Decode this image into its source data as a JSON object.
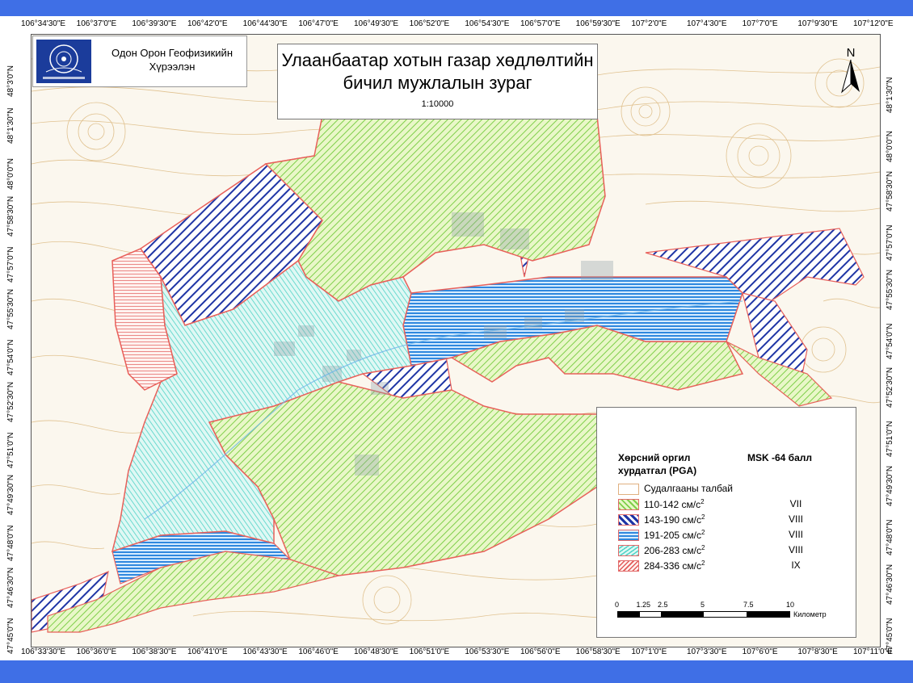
{
  "institute": {
    "line1": "Одон Орон Геофизикийн",
    "line2": "Хүрээлэн",
    "logo": "mongolian-academy-of-sciences-emblem"
  },
  "title": {
    "line1": "Улаанбаатар хотын газар хөдлөлтийн",
    "line2": "бичил мужлалын зураг",
    "scale": "1:10000"
  },
  "north_label": "N",
  "graticule": {
    "top": [
      "106°34'30\"E",
      "106°37'0\"E",
      "106°39'30\"E",
      "106°42'0\"E",
      "106°44'30\"E",
      "106°47'0\"E",
      "106°49'30\"E",
      "106°52'0\"E",
      "106°54'30\"E",
      "106°57'0\"E",
      "106°59'30\"E",
      "107°2'0\"E",
      "107°4'30\"E",
      "107°7'0\"E",
      "107°9'30\"E",
      "107°12'0\"E"
    ],
    "bottom": [
      "106°33'30\"E",
      "106°36'0\"E",
      "106°38'30\"E",
      "106°41'0\"E",
      "106°43'30\"E",
      "106°46'0\"E",
      "106°48'30\"E",
      "106°51'0\"E",
      "106°53'30\"E",
      "106°56'0\"E",
      "106°58'30\"E",
      "107°1'0\"E",
      "107°3'30\"E",
      "107°6'0\"E",
      "107°8'30\"E",
      "107°11'0\"E"
    ],
    "left": [
      "48°3'0\"N",
      "48°1'30\"N",
      "48°0'0\"N",
      "47°58'30\"N",
      "47°57'0\"N",
      "47°55'30\"N",
      "47°54'0\"N",
      "47°52'30\"N",
      "47°51'0\"N",
      "47°49'30\"N",
      "47°48'0\"N",
      "47°46'30\"N",
      "47°45'0\"N"
    ],
    "right": [
      "48°1'30\"N",
      "48°0'0\"N",
      "47°58'30\"N",
      "47°57'0\"N",
      "47°55'30\"N",
      "47°54'0\"N",
      "47°52'30\"N",
      "47°51'0\"N",
      "47°49'30\"N",
      "47°48'0\"N",
      "47°46'30\"N",
      "47°45'0\"N"
    ]
  },
  "legend": {
    "header_pga": [
      "Хөрсний оргил",
      "хурдатгал (PGA)"
    ],
    "header_msk": "MSK -64 балл",
    "items": [
      {
        "label": "Судалгааны талбай",
        "unit": "",
        "sup": "",
        "msk": "",
        "pattern": "none"
      },
      {
        "label": "110-142 см/с",
        "sup": "2",
        "msk": "VII",
        "pattern": "green"
      },
      {
        "label": "143-190 см/с",
        "sup": "2",
        "msk": "VIII",
        "pattern": "navy"
      },
      {
        "label": "191-205 см/с",
        "sup": "2",
        "msk": "VIII",
        "pattern": "blue"
      },
      {
        "label": "206-283 см/с",
        "sup": "2",
        "msk": "VIII",
        "pattern": "cyan"
      },
      {
        "label": "284-336 см/с",
        "sup": "2",
        "msk": "IX",
        "pattern": "red"
      }
    ]
  },
  "scalebar": {
    "ticks": [
      "0",
      "1.25",
      "2.5",
      "5",
      "7.5",
      "10"
    ],
    "tick_values": [
      0,
      1.25,
      2.5,
      5,
      7.5,
      10
    ],
    "unit": "Километр"
  },
  "colors": {
    "green": "#8fd65a",
    "navy": "#2036a8",
    "blue": "#3d8fe0",
    "cyan": "#5ad8d0",
    "red": "#e25a5a",
    "contour": "#d9b57a",
    "border": "#e8605a"
  }
}
